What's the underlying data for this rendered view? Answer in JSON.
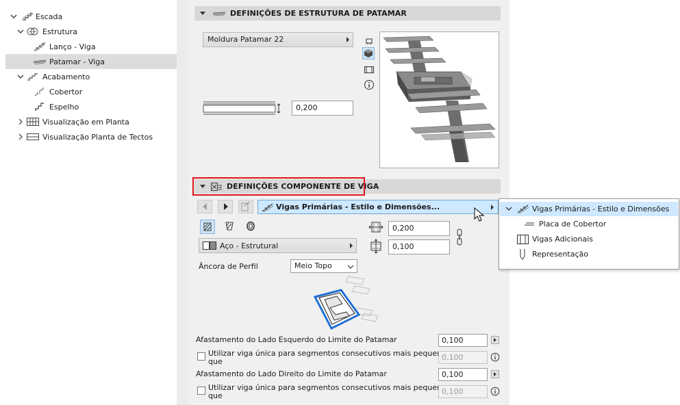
{
  "tree": {
    "items": [
      {
        "label": "Escada",
        "icon": "stair-icon",
        "chevron": "expanded"
      },
      {
        "label": "Estrutura",
        "icon": "structure-icon",
        "chevron": "expanded"
      },
      {
        "label": "Lanço - Viga",
        "icon": "flight-beam-icon"
      },
      {
        "label": "Patamar - Viga",
        "icon": "landing-beam-icon",
        "selected": true
      },
      {
        "label": "Acabamento",
        "icon": "finish-icon",
        "chevron": "expanded"
      },
      {
        "label": "Cobertor",
        "icon": "tread-icon"
      },
      {
        "label": "Espelho",
        "icon": "riser-icon"
      },
      {
        "label": "Visualização em Planta",
        "icon": "floorplan-icon",
        "chevron": "collapsed"
      },
      {
        "label": "Visualização Planta de Tectos",
        "icon": "ceiling-plan-icon",
        "chevron": "collapsed"
      }
    ]
  },
  "landing_section": {
    "title": "DEFINIÇÕES DE ESTRUTURA DE PATAMAR",
    "frame_value": "Moldura Patamar 22",
    "thickness": "0,200"
  },
  "beam_section": {
    "title": "DEFINIÇÕES COMPONENTE DE VIGA",
    "component_selector": "Vigas Primárias - Estilo e Dimensões...",
    "material": "Aço - Estrutural",
    "width": "0,200",
    "height": "0,100",
    "profile_anchor_label": "Âncora de Perfil",
    "profile_anchor_value": "Meio Topo",
    "left_offset_label": "Afastamento do Lado Esquerdo do Limite do Patamar",
    "left_offset_value": "0,100",
    "left_single_beam_label": "Utilizar viga única para segmentos consecutivos mais pequenos",
    "left_single_beam_label2": "que",
    "left_single_beam_value": "0,100",
    "right_offset_label": "Afastamento do Lado Direito do Limite do Patamar",
    "right_offset_value": "0,100",
    "right_single_beam_label": "Utilizar viga única para segmentos consecutivos mais pequenos",
    "right_single_beam_label2": "que",
    "right_single_beam_value": "0,100"
  },
  "popup_menu": {
    "items": [
      {
        "label": "Vigas Primárias - Estilo e Dimensões",
        "highlighted": true
      },
      {
        "label": "Placa de Cobertor"
      },
      {
        "label": "Vigas Adicionais"
      },
      {
        "label": "Representação"
      }
    ]
  },
  "colors": {
    "highlight_outline": "#e0141a",
    "selection": "#cde8ff",
    "tree_selected": "#dcdcdc",
    "profile_blue": "#1f6fd6"
  }
}
